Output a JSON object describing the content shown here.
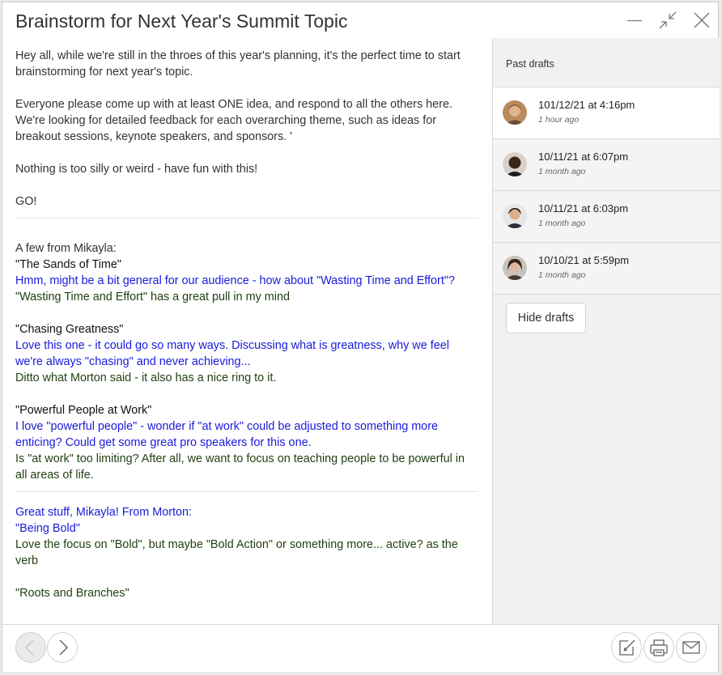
{
  "window": {
    "title": "Brainstorm for Next Year's Summit Topic",
    "controls": [
      "minimize-icon",
      "collapse-icon",
      "close-icon"
    ]
  },
  "message": {
    "intro": [
      "Hey all, while we're still in the throes of this year's planning, it's the perfect time to start brainstorming for next year's topic.",
      "Everyone please come up with at least ONE idea, and respond to all the others here. We're looking for detailed feedback for each overarching theme, such as ideas for breakout sessions, keynote speakers, and sponsors. '",
      "Nothing is too silly or weird - have fun with this!",
      "GO!"
    ],
    "mikayla": {
      "heading": "A few from Mikayla:",
      "ideas": [
        {
          "title": "\"The Sands of Time\"",
          "reply_blue": "Hmm, might be a bit general for our audience - how about \"Wasting Time and Effort\"?",
          "reply_green": "\"Wasting Time and Effort\" has a great pull in my mind"
        },
        {
          "title": "\"Chasing Greatness\"",
          "reply_blue": "Love this one - it could go so many ways. Discussing what is greatness, why we feel we're always \"chasing\" and never achieving...",
          "reply_green": "Ditto what Morton said - it also has a nice ring to it."
        },
        {
          "title": "\"Powerful People at Work\"",
          "reply_blue": "I love \"powerful people\" - wonder if \"at work\" could be adjusted to something more enticing? Could get some great pro speakers for this one.",
          "reply_green": "Is \"at work\" too limiting? After all, we want to focus on teaching people to be powerful in all areas of life."
        }
      ]
    },
    "morton": {
      "heading": "Great stuff, Mikayla! From Morton:",
      "idea1": "\"Being Bold\"",
      "reply1": "Love the focus on \"Bold\", but maybe \"Bold Action\" or something more... active? as the verb",
      "idea2": "\"Roots and Branches\""
    }
  },
  "sidebar": {
    "header": "Past drafts",
    "drafts": [
      {
        "date": "101/12/21 at 4:16pm",
        "ago": "1 hour ago"
      },
      {
        "date": "10/11/21 at 6:07pm",
        "ago": "1 month ago"
      },
      {
        "date": "10/11/21 at 6:03pm",
        "ago": "1 month ago"
      },
      {
        "date": "10/10/21 at 5:59pm",
        "ago": "1 month ago"
      }
    ],
    "hide_label": "Hide drafts"
  },
  "footer": {
    "icons": [
      "chevron-left-icon",
      "chevron-right-icon",
      "edit-icon",
      "print-icon",
      "mail-icon"
    ]
  },
  "colors": {
    "reply_blue": "#1a1adb",
    "reply_green": "#1f3f10"
  }
}
